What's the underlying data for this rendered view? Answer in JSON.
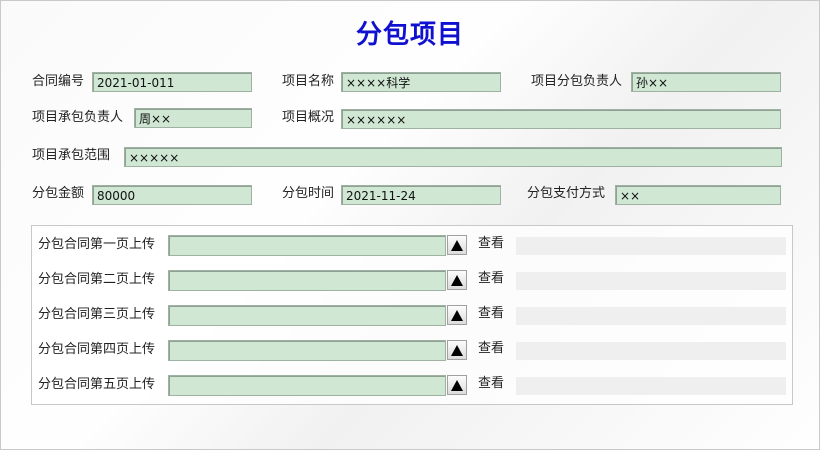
{
  "title": "分包项目",
  "fields": {
    "contract_no": {
      "label": "合同编号",
      "value": "2021-01-011"
    },
    "project_name": {
      "label": "项目名称",
      "value": "××××科学"
    },
    "subcontract_owner": {
      "label": "项目分包负责人",
      "value": "孙××"
    },
    "contract_owner": {
      "label": "项目承包负责人",
      "value": "周××"
    },
    "overview": {
      "label": "项目概况",
      "value": "××××××"
    },
    "scope": {
      "label": "项目承包范围",
      "value": "×××××"
    },
    "amount": {
      "label": "分包金额",
      "value": "80000"
    },
    "time": {
      "label": "分包时间",
      "value": "2021-11-24"
    },
    "pay_method": {
      "label": "分包支付方式",
      "value": "××"
    }
  },
  "uploads": {
    "view_label": "查看",
    "items": [
      {
        "label": "分包合同第一页上传",
        "value": ""
      },
      {
        "label": "分包合同第二页上传",
        "value": ""
      },
      {
        "label": "分包合同第三页上传",
        "value": ""
      },
      {
        "label": "分包合同第四页上传",
        "value": ""
      },
      {
        "label": "分包合同第五页上传",
        "value": ""
      }
    ]
  }
}
